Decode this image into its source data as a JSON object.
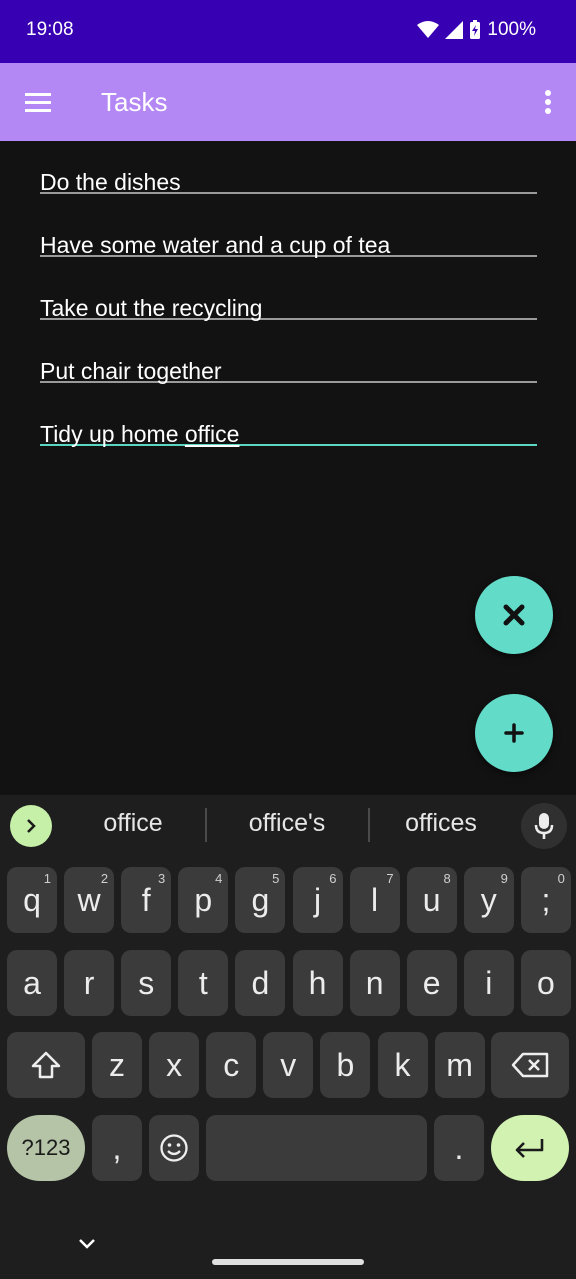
{
  "status_bar": {
    "time": "19:08",
    "battery": "100%"
  },
  "app_bar": {
    "title": "Tasks"
  },
  "tasks": [
    "Do the dishes",
    "Have some water and a cup of tea",
    "Take out the recycling",
    "Put chair together"
  ],
  "editing_task": {
    "prefix": "Tidy up home ",
    "underlined": "office"
  },
  "suggestions": [
    "office",
    "office's",
    "offices"
  ],
  "keyboard": {
    "row1": [
      {
        "k": "q",
        "h": "1"
      },
      {
        "k": "w",
        "h": "2"
      },
      {
        "k": "f",
        "h": "3"
      },
      {
        "k": "p",
        "h": "4"
      },
      {
        "k": "g",
        "h": "5"
      },
      {
        "k": "j",
        "h": "6"
      },
      {
        "k": "l",
        "h": "7"
      },
      {
        "k": "u",
        "h": "8"
      },
      {
        "k": "y",
        "h": "9"
      },
      {
        "k": ";",
        "h": "0"
      }
    ],
    "row2": [
      "a",
      "r",
      "s",
      "t",
      "d",
      "h",
      "n",
      "e",
      "i",
      "o"
    ],
    "row3": [
      "z",
      "x",
      "c",
      "v",
      "b",
      "k",
      "m"
    ],
    "symbols_label": "?123",
    "comma": ",",
    "period": "."
  },
  "colors": {
    "status_bar": "#3700b3",
    "app_bar": "#b388f4",
    "accent": "#63dbc9",
    "background": "#121212"
  }
}
